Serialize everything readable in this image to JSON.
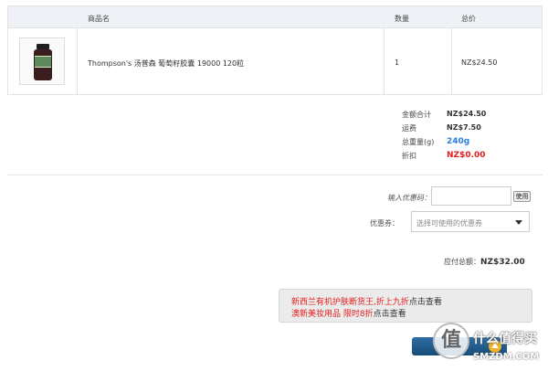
{
  "cart": {
    "headers": {
      "product": "商品名",
      "quantity": "数量",
      "total": "总价"
    },
    "item": {
      "name": "Thompson's 汤普森 葡萄籽胶囊 19000 120粒",
      "quantity": "1",
      "total": "NZ$24.50"
    }
  },
  "summary": {
    "subtotal_label": "金额合计",
    "subtotal": "NZ$24.50",
    "shipping_label": "运费",
    "shipping": "NZ$7.50",
    "weight_label": "总重量(g)",
    "weight": "240g",
    "discount_label": "折扣",
    "discount": "NZ$0.00"
  },
  "coupon": {
    "input_label": "输入优惠码：",
    "use_button": "使用",
    "select_label": "优惠券：",
    "select_placeholder": "选择可使用的优惠券"
  },
  "payable": {
    "label": "应付总额：",
    "amount": "NZ$32.00"
  },
  "promo": {
    "line1_red": "新西兰有机护肤断货王,折上九折",
    "line1_dark": "点击查看",
    "line2_red": "澳新美妆用品 限时8折",
    "line2_dark": "点击查看"
  },
  "watermark": {
    "logo": "值",
    "title": "什么值得买",
    "subtitle": "SMZDM.COM"
  },
  "colors": {
    "accent_blue": "#2a7de1",
    "accent_red": "#e02020",
    "button_blue": "#174c78"
  }
}
